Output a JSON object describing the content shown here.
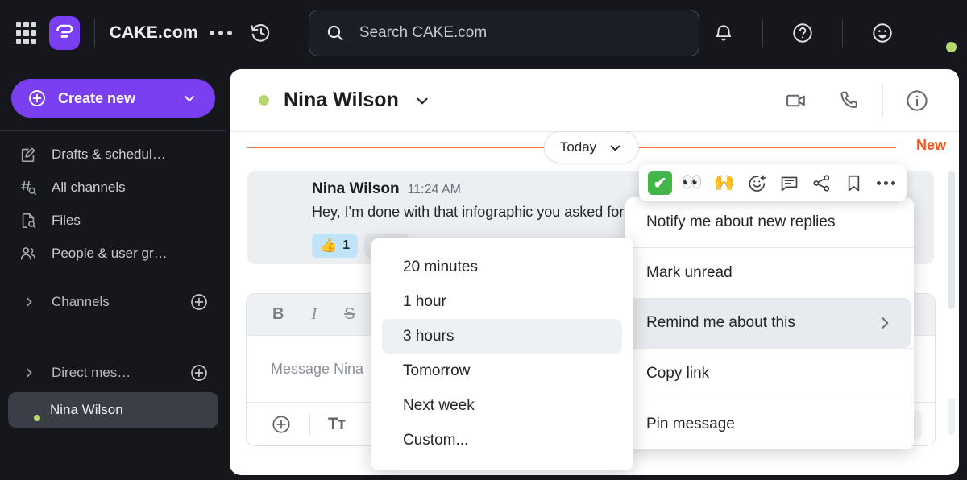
{
  "topbar": {
    "apps_icon": "grid-apps-icon",
    "logo_icon": "pumble-logo-icon",
    "workspace": "CAKE.com",
    "more_icon": "more-horizontal-icon",
    "history_icon": "history-clock-icon",
    "search": {
      "placeholder": "Search CAKE.com",
      "value": "",
      "icon": "search-icon"
    },
    "notifications_icon": "bell-icon",
    "help_icon": "question-circle-icon",
    "status_icon": "smiley-icon",
    "avatar": "user-avatar",
    "presence": "online"
  },
  "sidebar": {
    "create_new": {
      "label": "Create new",
      "plus_icon": "plus-circle-icon",
      "chevron_icon": "chevron-down-icon"
    },
    "nav_items": [
      {
        "label": "Drafts & schedul…",
        "icon": "drafts-pencil-icon"
      },
      {
        "label": "All channels",
        "icon": "hash-search-icon"
      },
      {
        "label": "Files",
        "icon": "file-search-icon"
      },
      {
        "label": "People & user gr…",
        "icon": "people-icon"
      }
    ],
    "sections": [
      {
        "label": "Channels",
        "chevron_icon": "chevron-right-icon",
        "add_icon": "plus-circle-icon"
      },
      {
        "label": "Direct mes…",
        "chevron_icon": "chevron-right-icon",
        "add_icon": "plus-circle-icon"
      }
    ],
    "dm_items": [
      {
        "name": "Nina Wilson",
        "presence": "online",
        "selected": true
      }
    ]
  },
  "conversation": {
    "name": "Nina Wilson",
    "presence": "online",
    "chevron_icon": "chevron-down-icon",
    "actions": [
      {
        "name": "video-call",
        "icon": "video-camera-icon"
      },
      {
        "name": "voice-call",
        "icon": "phone-icon"
      },
      {
        "name": "details",
        "icon": "info-circle-icon"
      }
    ],
    "date_pill": {
      "label": "Today",
      "chevron_icon": "chevron-down-icon"
    },
    "new_marker": "New",
    "message": {
      "author": "Nina Wilson",
      "time": "11:24 AM",
      "text": "Hey, I'm done with that infographic you asked for. Let me know if you need it today, ok?",
      "reactions": [
        {
          "emoji": "👍",
          "count": "1",
          "active": true
        },
        {
          "emoji": "",
          "count": "",
          "active": false
        }
      ]
    }
  },
  "composer": {
    "toolbar": [
      {
        "label": "B",
        "name": "bold-button"
      },
      {
        "label": "I",
        "name": "italic-button"
      },
      {
        "label": "S",
        "name": "strikethrough-button"
      }
    ],
    "placeholder": "Message Nina",
    "value": "",
    "attach_icon": "plus-circle-icon",
    "format_label": "Tᴛ",
    "send_dropdown_icon": "caret-down-icon"
  },
  "reaction_toolbar": {
    "items": [
      {
        "name": "white-check-mark-reaction",
        "glyph": "✔",
        "type": "check"
      },
      {
        "name": "eyes-reaction",
        "glyph": "👀",
        "type": "emoji"
      },
      {
        "name": "raised-hands-reaction",
        "glyph": "🙌",
        "type": "emoji"
      },
      {
        "name": "add-reaction-button",
        "glyph": "",
        "type": "icon-emoji-plus"
      },
      {
        "name": "reply-in-thread-button",
        "glyph": "",
        "type": "icon-comment"
      },
      {
        "name": "share-message-button",
        "glyph": "",
        "type": "icon-share"
      },
      {
        "name": "save-message-button",
        "glyph": "",
        "type": "icon-bookmark"
      },
      {
        "name": "more-actions-button",
        "glyph": "",
        "type": "icon-dots"
      }
    ]
  },
  "context_menu": {
    "groups": [
      [
        {
          "label": "Notify me about new replies",
          "highlighted": false,
          "submenu": false
        }
      ],
      [
        {
          "label": "Mark unread",
          "highlighted": false,
          "submenu": false
        },
        {
          "label": "Remind me about this",
          "highlighted": true,
          "submenu": true
        }
      ],
      [
        {
          "label": "Copy link",
          "highlighted": false,
          "submenu": false
        }
      ],
      [
        {
          "label": "Pin message",
          "highlighted": false,
          "submenu": false
        }
      ]
    ]
  },
  "submenu": {
    "items": [
      {
        "label": "20 minutes",
        "highlighted": false
      },
      {
        "label": "1 hour",
        "highlighted": false
      },
      {
        "label": "3 hours",
        "highlighted": true
      },
      {
        "label": "Tomorrow",
        "highlighted": false
      },
      {
        "label": "Next week",
        "highlighted": false
      },
      {
        "label": "Custom...",
        "highlighted": false
      }
    ]
  },
  "colors": {
    "brand_purple": "#7b3ff2",
    "dark_bg": "#15171c",
    "new_orange": "#f1561f",
    "presence_green": "#b5d96f",
    "reaction_blue": "#bfe3f7",
    "check_green": "#43b54a"
  }
}
